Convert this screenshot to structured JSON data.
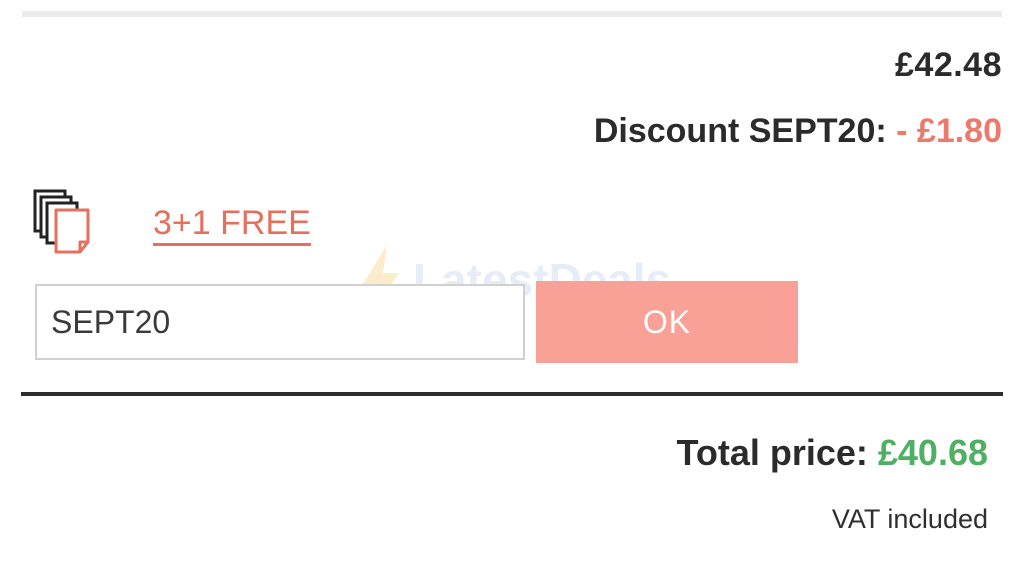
{
  "summary": {
    "subtotal": "£42.48",
    "discount_label": "Discount SEPT20:",
    "discount_value": "- £1.80"
  },
  "promo": {
    "icon": "stacked-documents-icon",
    "link_label": "3+1 FREE"
  },
  "coupon": {
    "code_value": "SEPT20",
    "submit_label": "OK"
  },
  "watermark": {
    "text": "LatestDeals",
    "icon": "lightning-bolt-icon"
  },
  "totals": {
    "label": "Total price:",
    "value": "£40.68",
    "vat_note": "VAT included"
  },
  "colors": {
    "discount": "#ec7a6c",
    "promo_link": "#e5705e",
    "ok_button": "#f9a097",
    "total_value": "#4faf63"
  }
}
